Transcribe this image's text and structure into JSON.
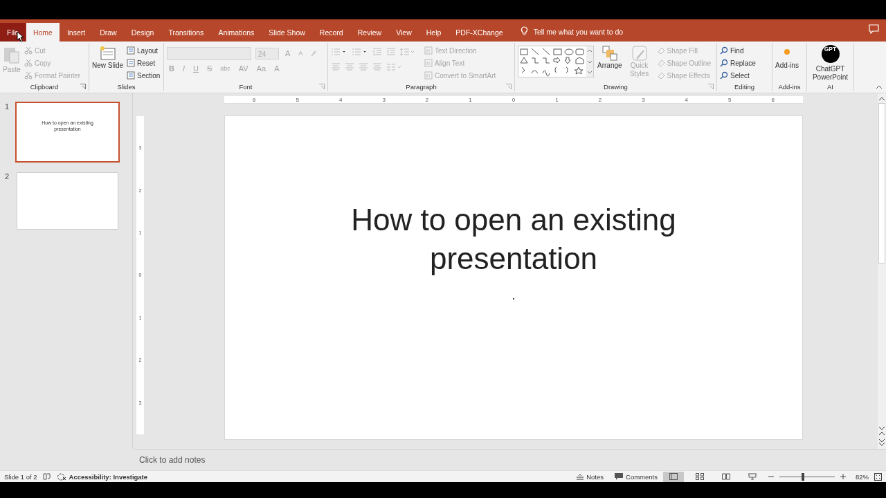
{
  "tabs": [
    {
      "label": "File",
      "selected": false,
      "hovered": true
    },
    {
      "label": "Home",
      "selected": true,
      "hovered": false
    },
    {
      "label": "Insert",
      "selected": false,
      "hovered": false
    },
    {
      "label": "Draw",
      "selected": false,
      "hovered": false
    },
    {
      "label": "Design",
      "selected": false,
      "hovered": false
    },
    {
      "label": "Transitions",
      "selected": false,
      "hovered": false
    },
    {
      "label": "Animations",
      "selected": false,
      "hovered": false
    },
    {
      "label": "Slide Show",
      "selected": false,
      "hovered": false
    },
    {
      "label": "Record",
      "selected": false,
      "hovered": false
    },
    {
      "label": "Review",
      "selected": false,
      "hovered": false
    },
    {
      "label": "View",
      "selected": false,
      "hovered": false
    },
    {
      "label": "Help",
      "selected": false,
      "hovered": false
    },
    {
      "label": "PDF-XChange",
      "selected": false,
      "hovered": false
    }
  ],
  "tell_me": "Tell me what you want to do",
  "ribbon": {
    "clipboard": {
      "label": "Clipboard",
      "paste": {
        "label": "Paste",
        "disabled": true
      },
      "items": [
        {
          "label": "Cut",
          "disabled": true
        },
        {
          "label": "Copy",
          "disabled": true
        },
        {
          "label": "Format Painter",
          "disabled": true
        }
      ]
    },
    "slides": {
      "label": "Slides",
      "new_slide": {
        "label": "New Slide",
        "disabled": false
      },
      "items": [
        {
          "label": "Layout",
          "disabled": false
        },
        {
          "label": "Reset",
          "disabled": false
        },
        {
          "label": "Section",
          "disabled": false
        }
      ]
    },
    "font": {
      "label": "Font",
      "size": "24",
      "disabled": true,
      "grow": "A",
      "shrink": "A",
      "buttons": [
        "B",
        "I",
        "U",
        "S",
        "abc",
        "AV",
        "Aa",
        "A"
      ]
    },
    "paragraph": {
      "label": "Paragraph",
      "disabled": true,
      "items": [
        "Text Direction",
        "Align Text",
        "Convert to SmartArt"
      ]
    },
    "drawing": {
      "label": "Drawing",
      "arrange": {
        "label": "Arrange",
        "disabled": false
      },
      "quick_styles": {
        "label": "Quick Styles",
        "disabled": true
      },
      "items": [
        {
          "label": "Shape Fill",
          "disabled": true
        },
        {
          "label": "Shape Outline",
          "disabled": true
        },
        {
          "label": "Shape Effects",
          "disabled": true
        }
      ]
    },
    "editing": {
      "label": "Editing",
      "items": [
        "Find",
        "Replace",
        "Select"
      ]
    },
    "addins": {
      "label": "Add-ins",
      "button": "Add-ins"
    },
    "ai": {
      "label": "AI",
      "logo": "GPT",
      "button": "ChatGPT PowerPoint"
    }
  },
  "thumbnails": [
    {
      "number": "1",
      "title": "How to open an existing presentation",
      "selected": true
    },
    {
      "number": "2",
      "selected": false
    }
  ],
  "ruler": {
    "horizontal": [
      "6",
      "5",
      "4",
      "3",
      "2",
      "1",
      "0",
      "1",
      "2",
      "3",
      "4",
      "5",
      "6"
    ],
    "vertical": [
      "3",
      "2",
      "1",
      "0",
      "1",
      "2",
      "3"
    ]
  },
  "slide": {
    "title": "How to open an existing presentation"
  },
  "notes_placeholder": "Click to add notes",
  "status_bar": {
    "slide_counter": "Slide 1 of 2",
    "accessibility": "Accessibility: Investigate",
    "notes": "Notes",
    "comments": "Comments",
    "views": [
      {
        "kind": "normal",
        "selected": true
      },
      {
        "kind": "sorter",
        "selected": false
      },
      {
        "kind": "reading",
        "selected": false
      },
      {
        "kind": "slideshow",
        "selected": false
      }
    ],
    "zoom": {
      "level": 0.4,
      "reading": "82%"
    }
  }
}
